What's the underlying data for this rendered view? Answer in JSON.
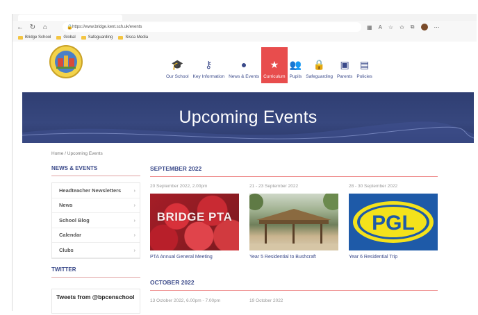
{
  "browser": {
    "url": "https://www.bridge.kent.sch.uk/events",
    "bookmarks": [
      "Bridge School",
      "Global",
      "Safeguarding",
      "Sisca Media"
    ]
  },
  "site": {
    "menu": [
      {
        "label": "Our School",
        "icon": "graduation-cap-icon",
        "active": false
      },
      {
        "label": "Key Information",
        "icon": "key-icon",
        "active": false
      },
      {
        "label": "News & Events",
        "icon": "bullhorn-icon",
        "active": false
      },
      {
        "label": "Curriculum",
        "icon": "star-icon",
        "active": true
      },
      {
        "label": "Pupils",
        "icon": "users-icon",
        "active": false
      },
      {
        "label": "Safeguarding",
        "icon": "lock-icon",
        "active": false
      },
      {
        "label": "Parents",
        "icon": "calendar-icon",
        "active": false
      },
      {
        "label": "Policies",
        "icon": "id-card-icon",
        "active": false
      }
    ],
    "accent": "#e84d4d",
    "brand": "#3b4a8a"
  },
  "banner": {
    "title": "Upcoming Events"
  },
  "breadcrumb": "Home / Upcoming Events",
  "sidebar": {
    "title": "NEWS & EVENTS",
    "items": [
      "Headteacher Newsletters",
      "News",
      "School Blog",
      "Calendar",
      "Clubs"
    ],
    "twitter_title": "TWITTER",
    "tweets_text": "Tweets from @bpcenschool"
  },
  "months": [
    "SEPTEMBER 2022",
    "OCTOBER 2022"
  ],
  "events": [
    {
      "date": "20 September 2022, 2.00pm",
      "title": "PTA Annual General Meeting",
      "image_text": "BRIDGE PTA"
    },
    {
      "date": "21 - 23 September 2022",
      "title": "Year 5 Residential to Bushcraft",
      "image_text": ""
    },
    {
      "date": "28 - 30 September 2022",
      "title": "Year 6 Residential Trip",
      "image_text": "PGL"
    },
    {
      "date": "13 October 2022, 6.00pm - 7.00pm",
      "title": "",
      "image_text": ""
    },
    {
      "date": "19 October 2022",
      "title": "",
      "image_text": ""
    }
  ]
}
